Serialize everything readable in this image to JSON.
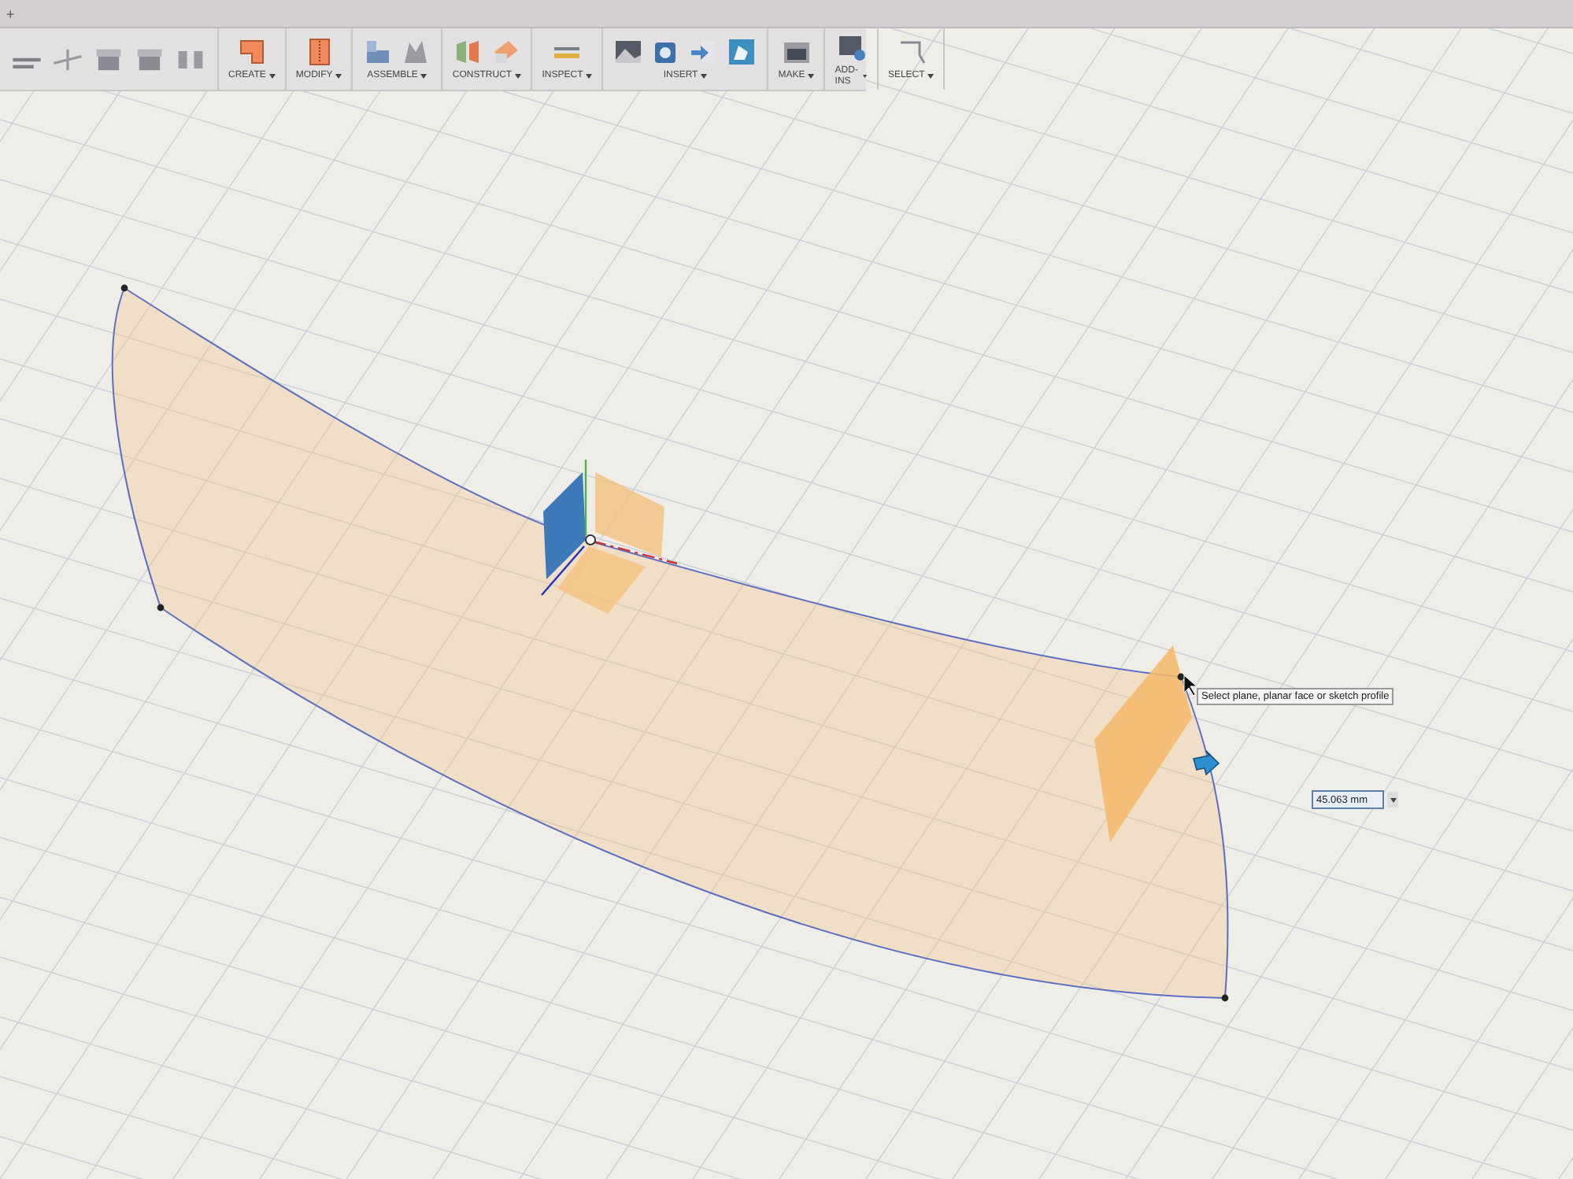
{
  "tab_strip": {
    "new_tab": "+"
  },
  "toolbar": {
    "groups": [
      {
        "kind": "sketch"
      },
      {
        "kind": "create",
        "label": "CREATE"
      },
      {
        "kind": "modify",
        "label": "MODIFY"
      },
      {
        "kind": "assemble",
        "label": "ASSEMBLE"
      },
      {
        "kind": "construct",
        "label": "CONSTRUCT"
      },
      {
        "kind": "inspect",
        "label": "INSPECT"
      },
      {
        "kind": "insert",
        "label": "INSERT"
      },
      {
        "kind": "make",
        "label": "MAKE"
      },
      {
        "kind": "addins",
        "label": "ADD-INS"
      },
      {
        "kind": "select",
        "label": "SELECT"
      }
    ]
  },
  "viewport": {
    "tooltip": "Select plane, planar face or sketch profile",
    "dimension_input": {
      "value": "45.063 mm"
    }
  }
}
